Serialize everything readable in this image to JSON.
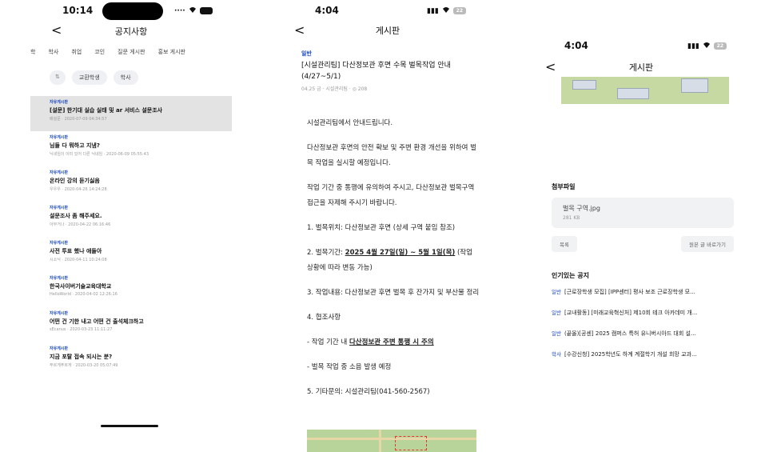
{
  "screen1": {
    "time": "10:14",
    "title": "공지사항",
    "back": "<",
    "tabs": [
      "학",
      "학사",
      "취업",
      "코인",
      "질문 게시판",
      "홍보 게시판"
    ],
    "chips": [
      "교환학생",
      "학사"
    ],
    "chip_icon": "⇅",
    "posts": [
      {
        "cat": "자유게시판",
        "title": "[설문] 한기대 실습 실태 및 ar 서비스 설문조사",
        "meta": "배설문 · 2020-07-09 04:34:57"
      },
      {
        "cat": "자유게시판",
        "title": "님들 다 뭐하고 지냄?",
        "meta": "닉네임이 이미 있어 다른 닉네임 · 2020-06-09 05:55:43"
      },
      {
        "cat": "자유게시판",
        "title": "온라인 강의 듣기싫음",
        "meta": "우우우 · 2020-04-26 14:24:28"
      },
      {
        "cat": "자유게시판",
        "title": "설문조사 좀 해주세요.",
        "meta": "아무거나 · 2020-04-22 06:16:46"
      },
      {
        "cat": "자유게시판",
        "title": "사전 투표 했나 애들아",
        "meta": "시소닉 · 2020-04-11 10:24:08"
      },
      {
        "cat": "자유게시판",
        "title": "한국사이버기술교육대학교",
        "meta": "HelloWorld · 2020-04-02 12:26:16"
      },
      {
        "cat": "자유게시판",
        "title": "어떤 건 기한 내고 어떤 건 출석체크하고",
        "meta": "sEcanus · 2020-03-23 11:11:27"
      },
      {
        "cat": "자유게시판",
        "title": "지금 포탈 접속 되시는 분?",
        "meta": "푸르게푸르게 · 2020-03-20 05:07:49"
      }
    ]
  },
  "screen2": {
    "time": "4:04",
    "battery": "22",
    "title": "게시판",
    "back": "<",
    "category": "일반",
    "post_title": "[시설관리팀] 다산정보관 후면 수목 벌목작업 안내 (4/27~5/1)",
    "meta": "04.25 금 · 시설관리팀 · ◎ 208",
    "paragraphs": [
      {
        "text": "시설관리팀에서 안내드립니다."
      },
      {
        "text": "다산정보관 후면의 안전 확보 및 주변 환경 개선을 위하여 벌목 작업을 실시할 예정입니다."
      },
      {
        "text": "작업 기간 중 통행에 유의하여 주시고, 다산정보관 벌목구역 접근을 자제해 주시기 바랍니다."
      },
      {
        "text": "1. 벌목위치: 다산정보관 후면 (상세 구역 붙임 참조)"
      },
      {
        "pre": "2. 벌목기간: ",
        "bold": "2025 4월 27일(일) ~ 5월 1일(목)",
        "post": " (작업 상황에 따라 변동 가능)"
      },
      {
        "text": "3. 작업내용: 다산정보관 후면 벌목 후 잔가지 및 부산물 정리"
      },
      {
        "text": "4. 협조사항"
      },
      {
        "pre": " - 작업 기간 내 ",
        "bold": "다산정보관 주변 통행 시 주의",
        "post": ""
      },
      {
        "text": " - 벌목 작업 중 소음 발생 예정"
      },
      {
        "text": "5. 기타문의: 시설관리팀(041-560-2567)"
      }
    ]
  },
  "screen3": {
    "time": "4:04",
    "battery": "22",
    "title": "게시판",
    "back": "<",
    "attachments_heading": "첨부파일",
    "file_name": "벌목 구역.jpg",
    "file_size": "281 KB",
    "list_button": "목록",
    "original_button": "원본 글 바로가기",
    "popular_heading": "인기있는 공지",
    "popular": [
      {
        "tag": "일반",
        "title": "[근로장학생 모집] [IPP센터] 평사 보조 근로장학생 모..."
      },
      {
        "tag": "일반",
        "title": "[교내활동] [미래교육혁신처] 제10회 테크 아카데미 개..."
      },
      {
        "tag": "일반",
        "title": "(끝올)[공센] 2025 캠퍼스 특허 유니버시아드 대회 설..."
      },
      {
        "tag": "학사",
        "title": "[수강신청] 2025학년도 하계 계절학기 개설 희망 교과..."
      }
    ]
  },
  "colors": {
    "accent": "#1a49c6",
    "highlight_row": "#e3e3e3",
    "chip_bg": "#eef0f3"
  }
}
